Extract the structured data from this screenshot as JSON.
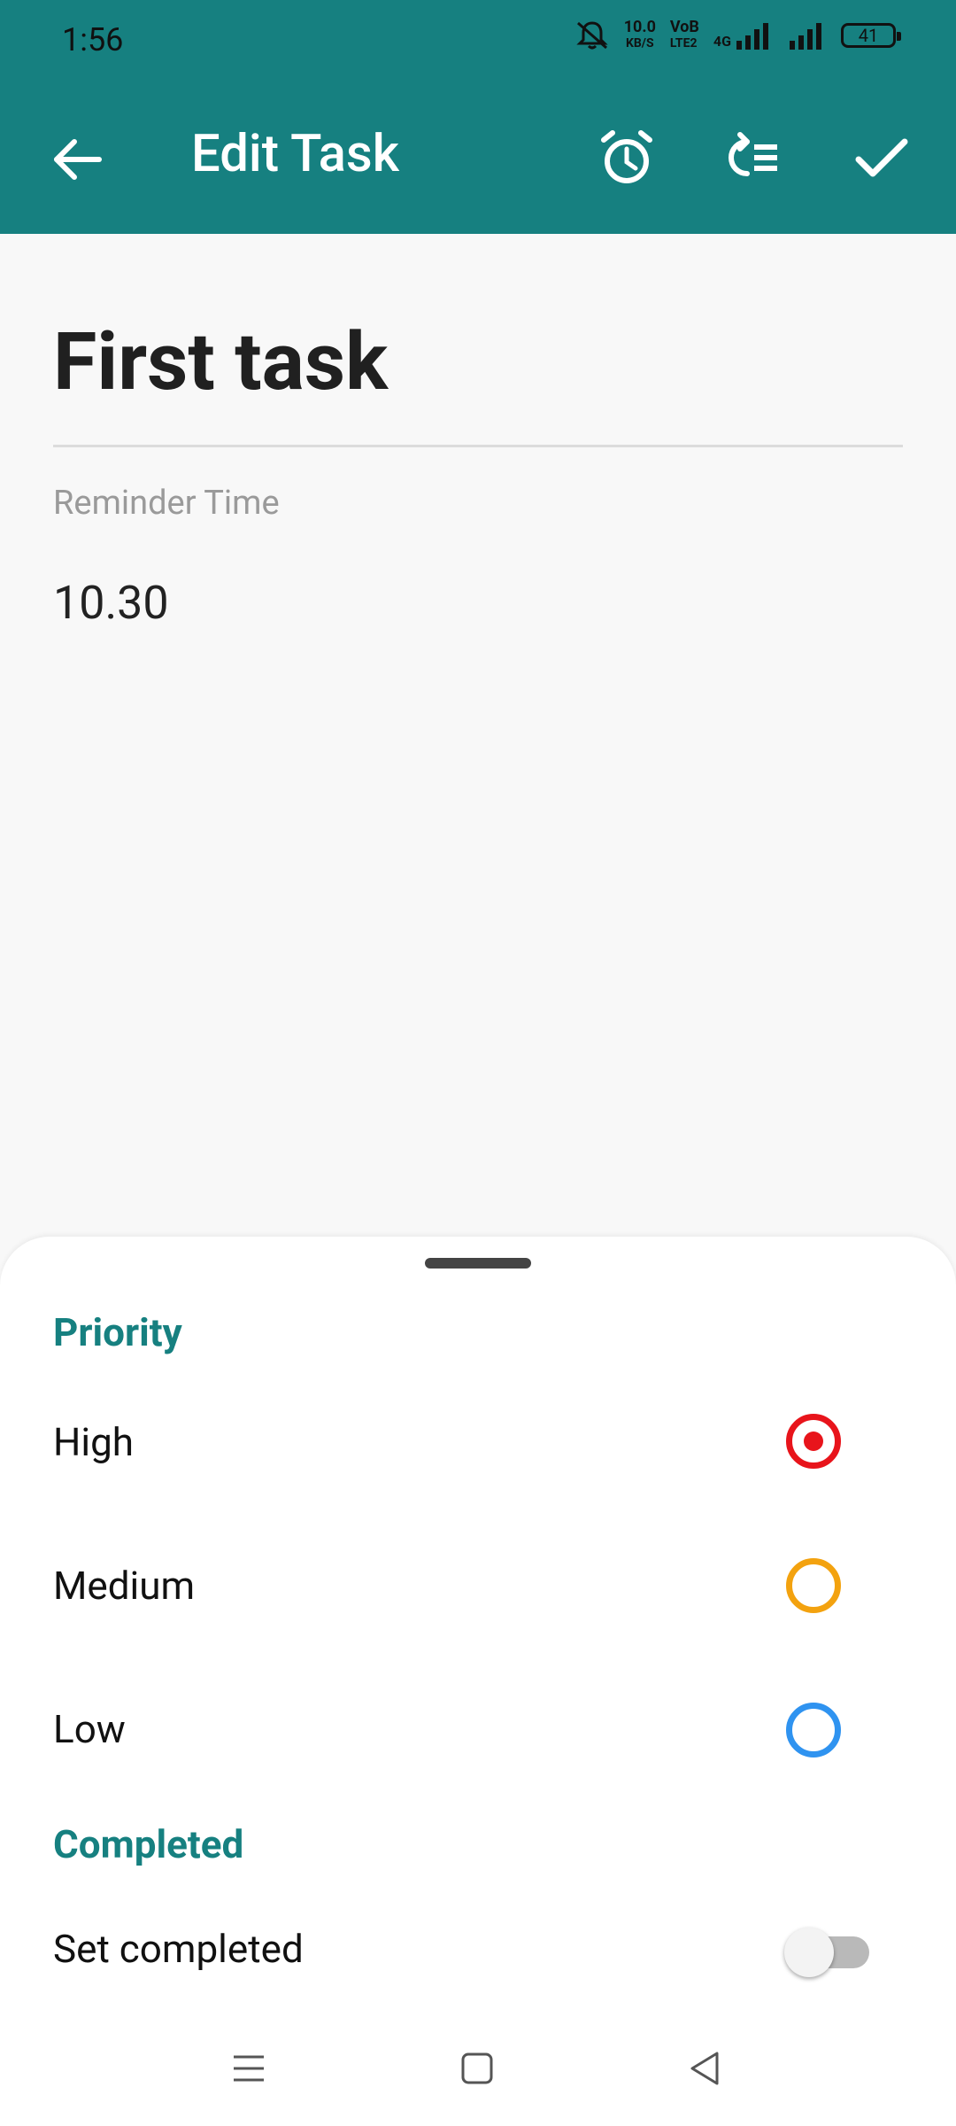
{
  "status_bar": {
    "time": "1:56",
    "net_speed_value": "10.0",
    "net_speed_unit": "KB/S",
    "volte_top": "VoB",
    "volte_bottom": "LTE2",
    "network_type": "4G",
    "battery": "41"
  },
  "app_bar": {
    "title": "Edit Task",
    "icons": [
      "arrow-back-icon",
      "alarm-icon",
      "repeat-list-icon",
      "check-icon"
    ]
  },
  "task": {
    "title": "First task",
    "reminder_label": "Reminder Time",
    "reminder_value": "10.30"
  },
  "sheet": {
    "priority_header": "Priority",
    "priorities": [
      {
        "label": "High",
        "color": "#e8141b",
        "selected": true
      },
      {
        "label": "Medium",
        "color": "#f3a20f",
        "selected": false
      },
      {
        "label": "Low",
        "color": "#2f93f0",
        "selected": false
      }
    ],
    "completed_header": "Completed",
    "set_completed_label": "Set completed",
    "set_completed_value": false
  },
  "colors": {
    "primary": "#168080",
    "background": "#f8f8f8"
  }
}
